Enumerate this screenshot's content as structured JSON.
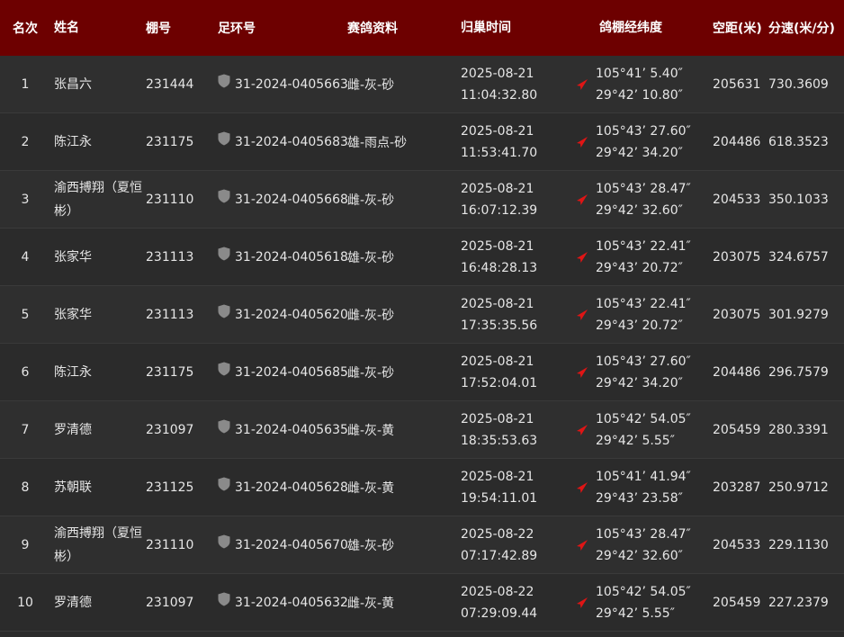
{
  "header": {
    "rank": "名次",
    "name": "姓名",
    "loft": "棚号",
    "ring": "足环号",
    "info": "赛鸽资料",
    "time": "归巢时间",
    "geo": "鸽棚经纬度",
    "distance": "空距(米)",
    "speed": "分速(米/分)"
  },
  "colors": {
    "header_bg": "#6d0000",
    "row_bg": "#2b2b2b",
    "arrow": "#e01515",
    "shield": "#8a8a8a"
  },
  "icons": {
    "ring": "shield-icon",
    "geo": "location-arrow-icon"
  },
  "rows": [
    {
      "rank": "1",
      "name": "张昌六",
      "loft": "231444",
      "ring": "31-2024-0405663",
      "info": "雌-灰-砂",
      "date": "2025-08-21",
      "clock": "11:04:32.80",
      "lon": "105°41’ 5.40″",
      "lat": "29°42’ 10.80″",
      "distance": "205631",
      "speed": "730.3609"
    },
    {
      "rank": "2",
      "name": "陈江永",
      "loft": "231175",
      "ring": "31-2024-0405683",
      "info": "雄-雨点-砂",
      "date": "2025-08-21",
      "clock": "11:53:41.70",
      "lon": "105°43’ 27.60″",
      "lat": "29°42’ 34.20″",
      "distance": "204486",
      "speed": "618.3523"
    },
    {
      "rank": "3",
      "name": "渝西搏翔（夏恒彬）",
      "loft": "231110",
      "ring": "31-2024-0405668",
      "info": "雌-灰-砂",
      "date": "2025-08-21",
      "clock": "16:07:12.39",
      "lon": "105°43’ 28.47″",
      "lat": "29°42’ 32.60″",
      "distance": "204533",
      "speed": "350.1033"
    },
    {
      "rank": "4",
      "name": "张家华",
      "loft": "231113",
      "ring": "31-2024-0405618",
      "info": "雄-灰-砂",
      "date": "2025-08-21",
      "clock": "16:48:28.13",
      "lon": "105°43’ 22.41″",
      "lat": "29°43’ 20.72″",
      "distance": "203075",
      "speed": "324.6757"
    },
    {
      "rank": "5",
      "name": "张家华",
      "loft": "231113",
      "ring": "31-2024-0405620",
      "info": "雌-灰-砂",
      "date": "2025-08-21",
      "clock": "17:35:35.56",
      "lon": "105°43’ 22.41″",
      "lat": "29°43’ 20.72″",
      "distance": "203075",
      "speed": "301.9279"
    },
    {
      "rank": "6",
      "name": "陈江永",
      "loft": "231175",
      "ring": "31-2024-0405685",
      "info": "雌-灰-砂",
      "date": "2025-08-21",
      "clock": "17:52:04.01",
      "lon": "105°43’ 27.60″",
      "lat": "29°42’ 34.20″",
      "distance": "204486",
      "speed": "296.7579"
    },
    {
      "rank": "7",
      "name": "罗清德",
      "loft": "231097",
      "ring": "31-2024-0405635",
      "info": "雌-灰-黄",
      "date": "2025-08-21",
      "clock": "18:35:53.63",
      "lon": "105°42’ 54.05″",
      "lat": "29°42’ 5.55″",
      "distance": "205459",
      "speed": "280.3391"
    },
    {
      "rank": "8",
      "name": "苏朝联",
      "loft": "231125",
      "ring": "31-2024-0405628",
      "info": "雌-灰-黄",
      "date": "2025-08-21",
      "clock": "19:54:11.01",
      "lon": "105°41’ 41.94″",
      "lat": "29°43’ 23.58″",
      "distance": "203287",
      "speed": "250.9712"
    },
    {
      "rank": "9",
      "name": "渝西搏翔（夏恒彬）",
      "loft": "231110",
      "ring": "31-2024-0405670",
      "info": "雄-灰-砂",
      "date": "2025-08-22",
      "clock": "07:17:42.89",
      "lon": "105°43’ 28.47″",
      "lat": "29°42’ 32.60″",
      "distance": "204533",
      "speed": "229.1130"
    },
    {
      "rank": "10",
      "name": "罗清德",
      "loft": "231097",
      "ring": "31-2024-0405632",
      "info": "雌-灰-黄",
      "date": "2025-08-22",
      "clock": "07:29:09.44",
      "lon": "105°42’ 54.05″",
      "lat": "29°42’ 5.55″",
      "distance": "205459",
      "speed": "227.2379"
    }
  ]
}
